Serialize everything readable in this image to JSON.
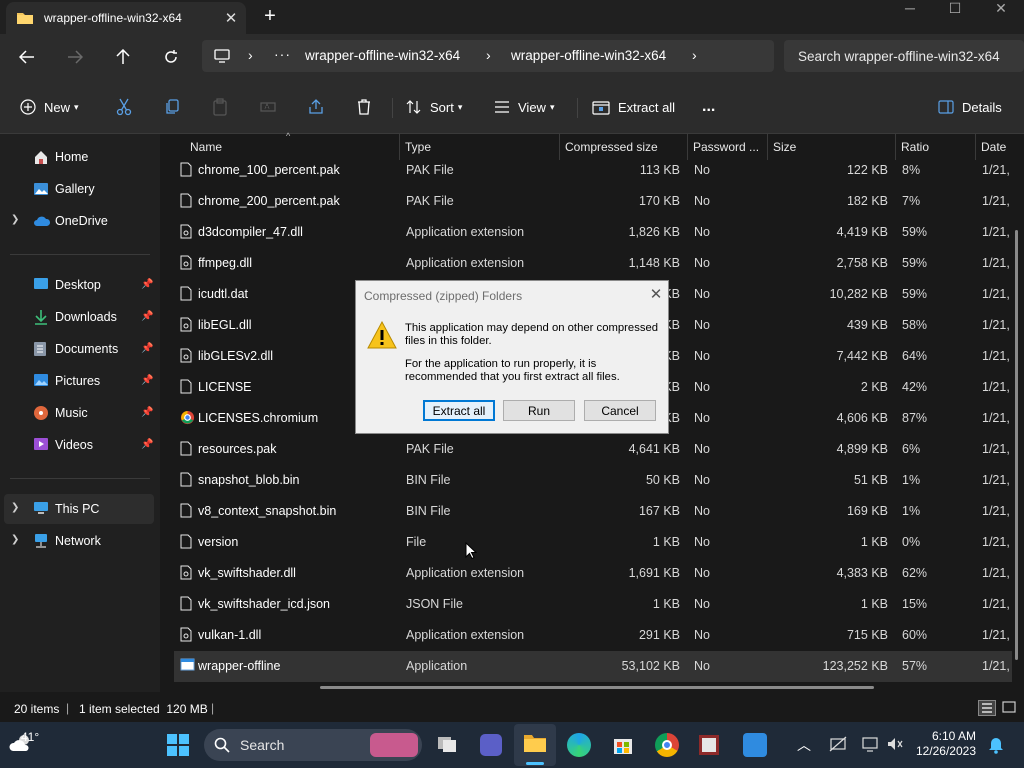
{
  "window": {
    "tab_title": "wrapper-offline-win32-x64"
  },
  "address": {
    "segments": [
      "wrapper-offline-win32-x64",
      "wrapper-offline-win32-x64"
    ],
    "search_placeholder": "Search wrapper-offline-win32-x64"
  },
  "toolbar": {
    "new_label": "New",
    "sort_label": "Sort",
    "view_label": "View",
    "extract_label": "Extract all",
    "more_label": "...",
    "details_label": "Details"
  },
  "sidebar": {
    "items": [
      {
        "label": "Home",
        "icon": "home-icon"
      },
      {
        "label": "Gallery",
        "icon": "gallery-icon"
      },
      {
        "label": "OneDrive",
        "icon": "cloud-icon"
      },
      {
        "label": "Desktop",
        "icon": "desktop-icon"
      },
      {
        "label": "Downloads",
        "icon": "download-icon"
      },
      {
        "label": "Documents",
        "icon": "documents-icon"
      },
      {
        "label": "Pictures",
        "icon": "pictures-icon"
      },
      {
        "label": "Music",
        "icon": "music-icon"
      },
      {
        "label": "Videos",
        "icon": "videos-icon"
      },
      {
        "label": "This PC",
        "icon": "computer-icon"
      },
      {
        "label": "Network",
        "icon": "network-icon"
      }
    ]
  },
  "columns": [
    "Name",
    "Type",
    "Compressed size",
    "Password ...",
    "Size",
    "Ratio",
    "Date"
  ],
  "files": [
    {
      "name": "chrome_100_percent.pak",
      "type": "PAK File",
      "csize": "113 KB",
      "pw": "No",
      "size": "122 KB",
      "ratio": "8%",
      "date": "1/21,"
    },
    {
      "name": "chrome_200_percent.pak",
      "type": "PAK File",
      "csize": "170 KB",
      "pw": "No",
      "size": "182 KB",
      "ratio": "7%",
      "date": "1/21,"
    },
    {
      "name": "d3dcompiler_47.dll",
      "type": "Application extension",
      "csize": "1,826 KB",
      "pw": "No",
      "size": "4,419 KB",
      "ratio": "59%",
      "date": "1/21,"
    },
    {
      "name": "ffmpeg.dll",
      "type": "Application extension",
      "csize": "1,148 KB",
      "pw": "No",
      "size": "2,758 KB",
      "ratio": "59%",
      "date": "1/21,"
    },
    {
      "name": "icudtl.dat",
      "type": "",
      "csize": "KB",
      "pw": "No",
      "size": "10,282 KB",
      "ratio": "59%",
      "date": "1/21,"
    },
    {
      "name": "libEGL.dll",
      "type": "",
      "csize": "KB",
      "pw": "No",
      "size": "439 KB",
      "ratio": "58%",
      "date": "1/21,"
    },
    {
      "name": "libGLESv2.dll",
      "type": "",
      "csize": "KB",
      "pw": "No",
      "size": "7,442 KB",
      "ratio": "64%",
      "date": "1/21,"
    },
    {
      "name": "LICENSE",
      "type": "",
      "csize": "KB",
      "pw": "No",
      "size": "2 KB",
      "ratio": "42%",
      "date": "1/21,"
    },
    {
      "name": "LICENSES.chromium",
      "type": "",
      "csize": "KB",
      "pw": "No",
      "size": "4,606 KB",
      "ratio": "87%",
      "date": "1/21,"
    },
    {
      "name": "resources.pak",
      "type": "PAK File",
      "csize": "4,641 KB",
      "pw": "No",
      "size": "4,899 KB",
      "ratio": "6%",
      "date": "1/21,"
    },
    {
      "name": "snapshot_blob.bin",
      "type": "BIN File",
      "csize": "50 KB",
      "pw": "No",
      "size": "51 KB",
      "ratio": "1%",
      "date": "1/21,"
    },
    {
      "name": "v8_context_snapshot.bin",
      "type": "BIN File",
      "csize": "167 KB",
      "pw": "No",
      "size": "169 KB",
      "ratio": "1%",
      "date": "1/21,"
    },
    {
      "name": "version",
      "type": "File",
      "csize": "1 KB",
      "pw": "No",
      "size": "1 KB",
      "ratio": "0%",
      "date": "1/21,"
    },
    {
      "name": "vk_swiftshader.dll",
      "type": "Application extension",
      "csize": "1,691 KB",
      "pw": "No",
      "size": "4,383 KB",
      "ratio": "62%",
      "date": "1/21,"
    },
    {
      "name": "vk_swiftshader_icd.json",
      "type": "JSON File",
      "csize": "1 KB",
      "pw": "No",
      "size": "1 KB",
      "ratio": "15%",
      "date": "1/21,"
    },
    {
      "name": "vulkan-1.dll",
      "type": "Application extension",
      "csize": "291 KB",
      "pw": "No",
      "size": "715 KB",
      "ratio": "60%",
      "date": "1/21,"
    },
    {
      "name": "wrapper-offline",
      "type": "Application",
      "csize": "53,102 KB",
      "pw": "No",
      "size": "123,252 KB",
      "ratio": "57%",
      "date": "1/21,"
    }
  ],
  "status": {
    "count": "20 items",
    "selected": "1 item selected  120 MB"
  },
  "dialog": {
    "title": "Compressed (zipped) Folders",
    "line1": "This application may depend on other compressed files in this folder.",
    "line2": "For the application to run properly, it is recommended that you first extract all files.",
    "extract": "Extract all",
    "run": "Run",
    "cancel": "Cancel"
  },
  "taskbar": {
    "temp": "41°",
    "search": "Search",
    "time": "6:10 AM",
    "date": "12/26/2023"
  }
}
